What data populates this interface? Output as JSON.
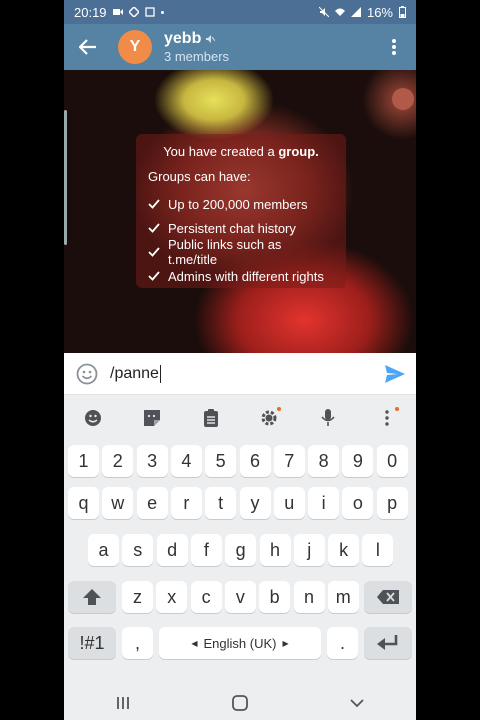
{
  "status_bar": {
    "time": "20:19",
    "battery": "16%"
  },
  "header": {
    "avatar_letter": "Y",
    "title": "yebb",
    "subtitle": "3 members"
  },
  "service_message": {
    "title_prefix": "You have created a ",
    "title_bold": "group.",
    "subtitle": "Groups can have:",
    "features": [
      "Up to 200,000 members",
      "Persistent chat history",
      "Public links such as t.me/title",
      "Admins with different rights"
    ]
  },
  "composer": {
    "text": "/panne"
  },
  "keyboard": {
    "digits": [
      "1",
      "2",
      "3",
      "4",
      "5",
      "6",
      "7",
      "8",
      "9",
      "0"
    ],
    "row1": [
      "q",
      "w",
      "e",
      "r",
      "t",
      "y",
      "u",
      "i",
      "o",
      "p"
    ],
    "row2": [
      "a",
      "s",
      "d",
      "f",
      "g",
      "h",
      "j",
      "k",
      "l"
    ],
    "row3": [
      "z",
      "x",
      "c",
      "v",
      "b",
      "n",
      "m"
    ],
    "symbols_key": "!#1",
    "comma_key": ",",
    "space_label": "English (UK)",
    "period_key": "."
  },
  "colors": {
    "header": "#5682a3",
    "status_bar": "#4b6f95",
    "avatar": "#f08c47",
    "send": "#4ea4f6"
  }
}
